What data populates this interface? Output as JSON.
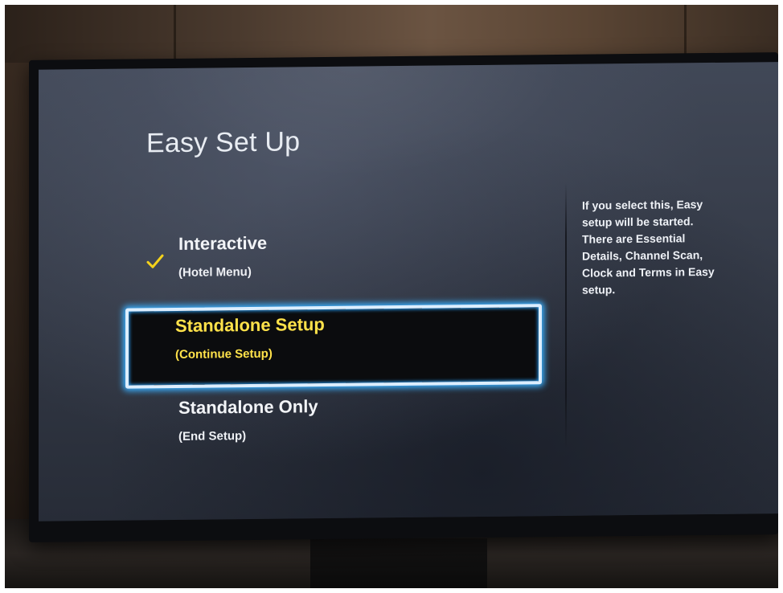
{
  "screen": {
    "title": "Easy Set Up"
  },
  "menu": {
    "items": [
      {
        "label": "Interactive",
        "sub": "(Hotel Menu)"
      },
      {
        "label": "Standalone Setup",
        "sub": "(Continue Setup)"
      },
      {
        "label": "Standalone Only",
        "sub": "(End Setup)"
      }
    ],
    "checked_index": 0,
    "focused_index": 1
  },
  "help": {
    "lines": [
      "If you select this, Easy",
      "setup will be started.",
      "There are Essential",
      "Details, Channel Scan,",
      "Clock and Terms in Easy",
      "setup."
    ]
  },
  "icons": {
    "check": "check-icon"
  },
  "colors": {
    "focus_text": "#ffe24a",
    "focus_border": "#3ab0ff",
    "check": "#f4d21c"
  }
}
